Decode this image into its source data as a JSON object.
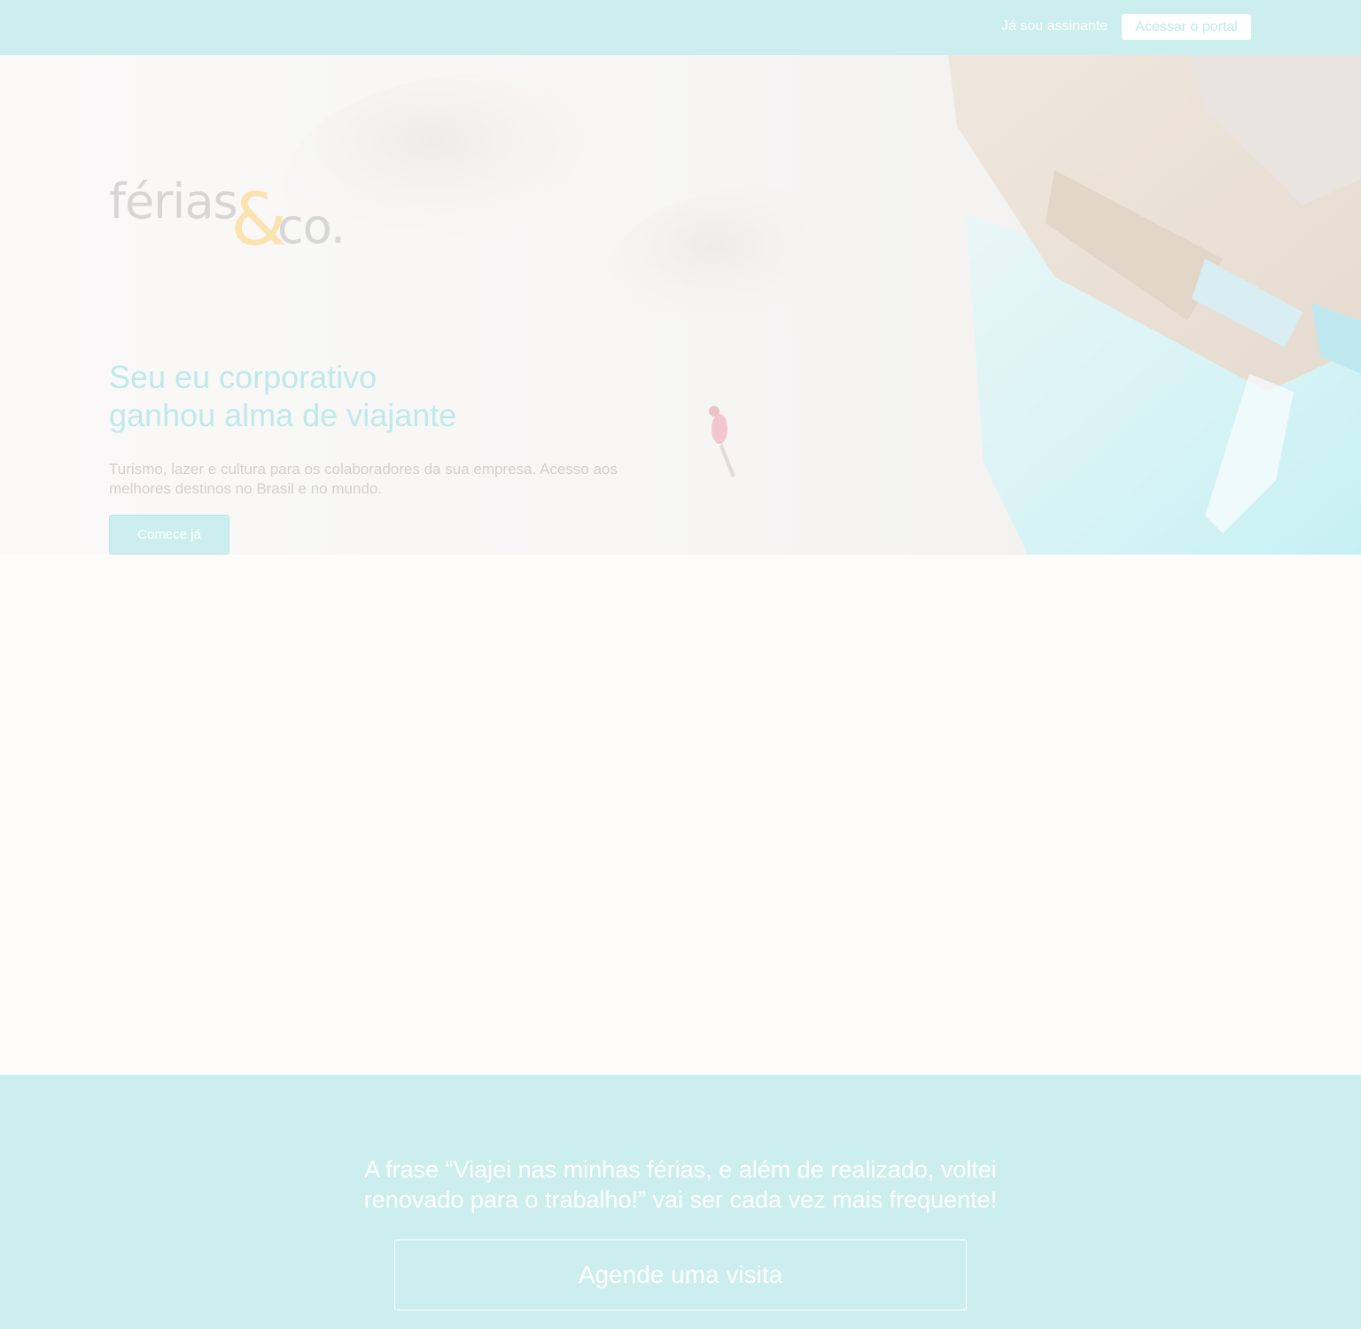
{
  "topbar": {
    "member_text": "Já sou assinante",
    "portal_button": "Acessar o portal"
  },
  "hero": {
    "logo": {
      "word": "férias",
      "ampersand": "&",
      "suffix": "co."
    },
    "title_line1": "Seu eu corporativo",
    "title_line2": "ganhou alma de viajante",
    "subtitle": "Turismo, lazer e cultura para os colaboradores da sua empresa. Acesso aos melhores destinos no Brasil e no mundo.",
    "cta_button": "Comece já"
  },
  "bottom": {
    "quote_line1": "A frase “Viajei nas minhas férias, e além de realizado, voltei",
    "quote_line2": "renovado para o trabalho!” vai ser cada vez mais frequente!",
    "visit_button": "Agende uma visita"
  },
  "colors": {
    "accent": "#cdeeee",
    "title": "#bfe9ea",
    "logo_amp": "#fbe3b0",
    "logo_text": "#d6d6d6"
  }
}
